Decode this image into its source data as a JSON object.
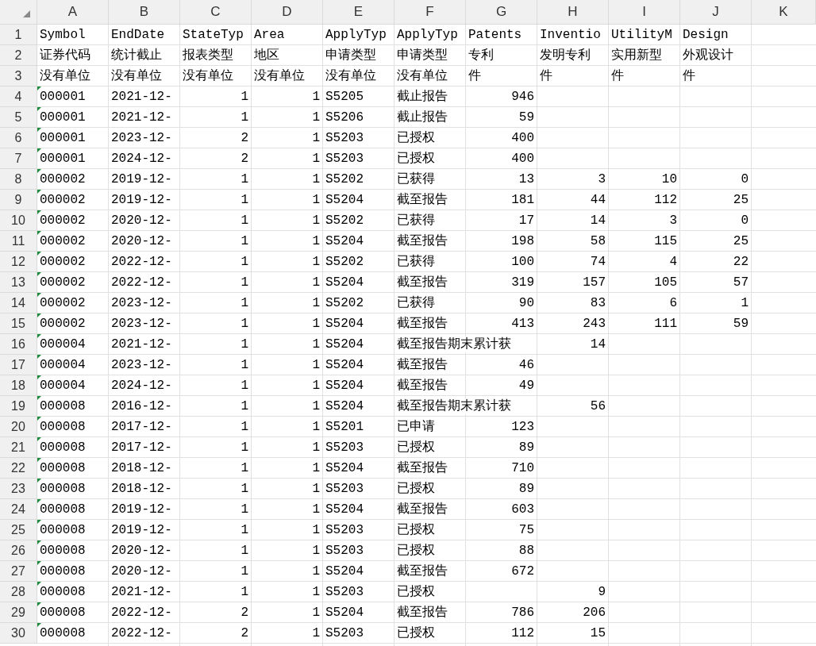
{
  "columns": [
    {
      "letter": "A",
      "kind": "flagged"
    },
    {
      "letter": "B",
      "kind": "text"
    },
    {
      "letter": "C",
      "kind": "number"
    },
    {
      "letter": "D",
      "kind": "number"
    },
    {
      "letter": "E",
      "kind": "text"
    },
    {
      "letter": "F",
      "kind": "text"
    },
    {
      "letter": "G",
      "kind": "number"
    },
    {
      "letter": "H",
      "kind": "number"
    },
    {
      "letter": "I",
      "kind": "number"
    },
    {
      "letter": "J",
      "kind": "number"
    },
    {
      "letter": "K",
      "kind": "number"
    }
  ],
  "header_rows": [
    {
      "number": "1",
      "cells": [
        "Symbol",
        "EndDate",
        "StateTyp",
        "Area",
        "ApplyTyp",
        "ApplyTyp",
        "Patents",
        "Inventio",
        "UtilityM",
        "Design"
      ]
    },
    {
      "number": "2",
      "cells": [
        "证券代码",
        "统计截止",
        "报表类型",
        "地区",
        "申请类型",
        "申请类型",
        "专利",
        "发明专利",
        "实用新型",
        "外观设计"
      ]
    },
    {
      "number": "3",
      "cells": [
        "没有单位",
        "没有单位",
        "没有单位",
        "没有单位",
        "没有单位",
        "没有单位",
        "件",
        "件",
        "件",
        "件"
      ]
    }
  ],
  "rows": [
    {
      "number": "4",
      "cells": [
        "000001",
        "2021-12-",
        "1",
        "1",
        "S5205",
        "截止报告",
        "946"
      ]
    },
    {
      "number": "5",
      "cells": [
        "000001",
        "2021-12-",
        "1",
        "1",
        "S5206",
        "截止报告",
        "59"
      ]
    },
    {
      "number": "6",
      "cells": [
        "000001",
        "2023-12-",
        "2",
        "1",
        "S5203",
        "已授权",
        "400"
      ]
    },
    {
      "number": "7",
      "cells": [
        "000001",
        "2024-12-",
        "2",
        "1",
        "S5203",
        "已授权",
        "400"
      ]
    },
    {
      "number": "8",
      "cells": [
        "000002",
        "2019-12-",
        "1",
        "1",
        "S5202",
        "已获得",
        "13",
        "3",
        "10",
        "0"
      ]
    },
    {
      "number": "9",
      "cells": [
        "000002",
        "2019-12-",
        "1",
        "1",
        "S5204",
        "截至报告",
        "181",
        "44",
        "112",
        "25"
      ]
    },
    {
      "number": "10",
      "cells": [
        "000002",
        "2020-12-",
        "1",
        "1",
        "S5202",
        "已获得",
        "17",
        "14",
        "3",
        "0"
      ]
    },
    {
      "number": "11",
      "cells": [
        "000002",
        "2020-12-",
        "1",
        "1",
        "S5204",
        "截至报告",
        "198",
        "58",
        "115",
        "25"
      ]
    },
    {
      "number": "12",
      "cells": [
        "000002",
        "2022-12-",
        "1",
        "1",
        "S5202",
        "已获得",
        "100",
        "74",
        "4",
        "22"
      ]
    },
    {
      "number": "13",
      "cells": [
        "000002",
        "2022-12-",
        "1",
        "1",
        "S5204",
        "截至报告",
        "319",
        "157",
        "105",
        "57"
      ]
    },
    {
      "number": "14",
      "cells": [
        "000002",
        "2023-12-",
        "1",
        "1",
        "S5202",
        "已获得",
        "90",
        "83",
        "6",
        "1"
      ]
    },
    {
      "number": "15",
      "cells": [
        "000002",
        "2023-12-",
        "1",
        "1",
        "S5204",
        "截至报告",
        "413",
        "243",
        "111",
        "59"
      ]
    },
    {
      "number": "16",
      "cells": [
        "000004",
        "2021-12-",
        "1",
        "1",
        "S5204",
        "截至报告期末累计获",
        null,
        "14"
      ]
    },
    {
      "number": "17",
      "cells": [
        "000004",
        "2023-12-",
        "1",
        "1",
        "S5204",
        "截至报告",
        "46"
      ]
    },
    {
      "number": "18",
      "cells": [
        "000004",
        "2024-12-",
        "1",
        "1",
        "S5204",
        "截至报告",
        "49"
      ]
    },
    {
      "number": "19",
      "cells": [
        "000008",
        "2016-12-",
        "1",
        "1",
        "S5204",
        "截至报告期末累计获",
        null,
        "56"
      ]
    },
    {
      "number": "20",
      "cells": [
        "000008",
        "2017-12-",
        "1",
        "1",
        "S5201",
        "已申请",
        "123"
      ]
    },
    {
      "number": "21",
      "cells": [
        "000008",
        "2017-12-",
        "1",
        "1",
        "S5203",
        "已授权",
        "89"
      ]
    },
    {
      "number": "22",
      "cells": [
        "000008",
        "2018-12-",
        "1",
        "1",
        "S5204",
        "截至报告",
        "710"
      ]
    },
    {
      "number": "23",
      "cells": [
        "000008",
        "2018-12-",
        "1",
        "1",
        "S5203",
        "已授权",
        "89"
      ]
    },
    {
      "number": "24",
      "cells": [
        "000008",
        "2019-12-",
        "1",
        "1",
        "S5204",
        "截至报告",
        "603"
      ]
    },
    {
      "number": "25",
      "cells": [
        "000008",
        "2019-12-",
        "1",
        "1",
        "S5203",
        "已授权",
        "75"
      ]
    },
    {
      "number": "26",
      "cells": [
        "000008",
        "2020-12-",
        "1",
        "1",
        "S5203",
        "已授权",
        "88"
      ]
    },
    {
      "number": "27",
      "cells": [
        "000008",
        "2020-12-",
        "1",
        "1",
        "S5204",
        "截至报告",
        "672"
      ]
    },
    {
      "number": "28",
      "cells": [
        "000008",
        "2021-12-",
        "1",
        "1",
        "S5203",
        "已授权",
        null,
        "9"
      ]
    },
    {
      "number": "29",
      "cells": [
        "000008",
        "2022-12-",
        "2",
        "1",
        "S5204",
        "截至报告",
        "786",
        "206"
      ]
    },
    {
      "number": "30",
      "cells": [
        "000008",
        "2022-12-",
        "2",
        "1",
        "S5203",
        "已授权",
        "112",
        "15"
      ]
    }
  ]
}
